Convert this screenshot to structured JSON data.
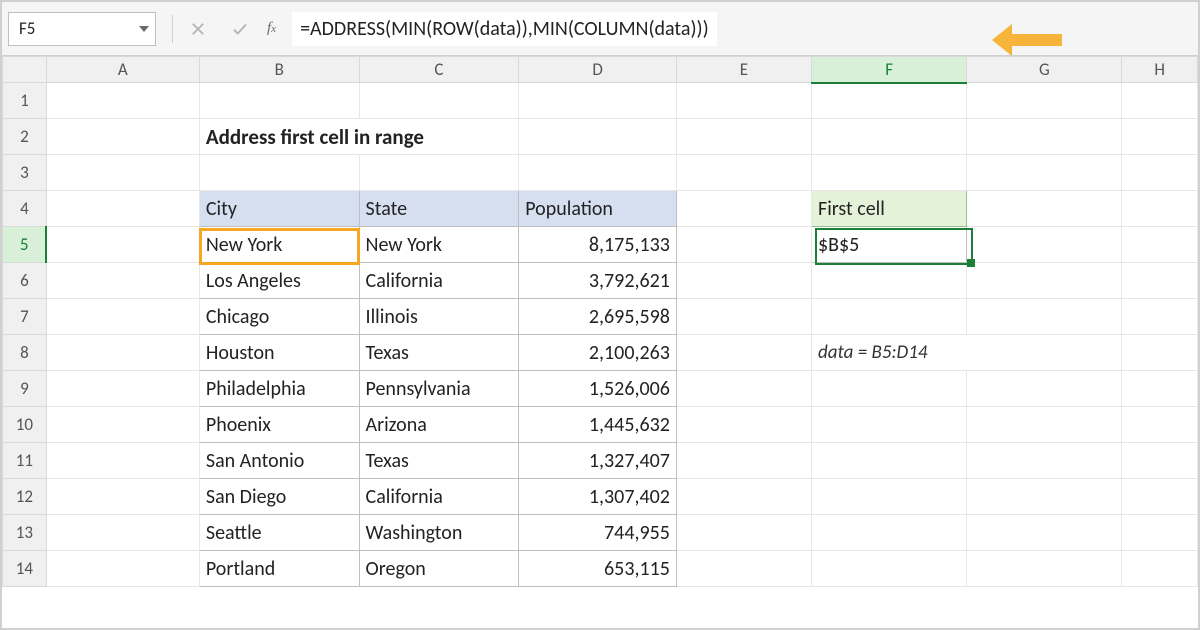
{
  "nameBox": "F5",
  "formula": "=ADDRESS(MIN(ROW(data)),MIN(COLUMN(data)))",
  "columns": [
    "A",
    "B",
    "C",
    "D",
    "E",
    "F",
    "G",
    "H"
  ],
  "rowNumbers": [
    1,
    2,
    3,
    4,
    5,
    6,
    7,
    8,
    9,
    10,
    11,
    12,
    13,
    14
  ],
  "title": "Address first cell in range",
  "table": {
    "headers": {
      "city": "City",
      "state": "State",
      "pop": "Population"
    },
    "rows": [
      {
        "city": "New York",
        "state": "New York",
        "pop": "8,175,133"
      },
      {
        "city": "Los Angeles",
        "state": "California",
        "pop": "3,792,621"
      },
      {
        "city": "Chicago",
        "state": "Illinois",
        "pop": "2,695,598"
      },
      {
        "city": "Houston",
        "state": "Texas",
        "pop": "2,100,263"
      },
      {
        "city": "Philadelphia",
        "state": "Pennsylvania",
        "pop": "1,526,006"
      },
      {
        "city": "Phoenix",
        "state": "Arizona",
        "pop": "1,445,632"
      },
      {
        "city": "San Antonio",
        "state": "Texas",
        "pop": "1,327,407"
      },
      {
        "city": "San Diego",
        "state": "California",
        "pop": "1,307,402"
      },
      {
        "city": "Seattle",
        "state": "Washington",
        "pop": "744,955"
      },
      {
        "city": "Portland",
        "state": "Oregon",
        "pop": "653,115"
      }
    ]
  },
  "resultHeader": "First cell",
  "resultValue": "$B$5",
  "note": "data = B5:D14"
}
